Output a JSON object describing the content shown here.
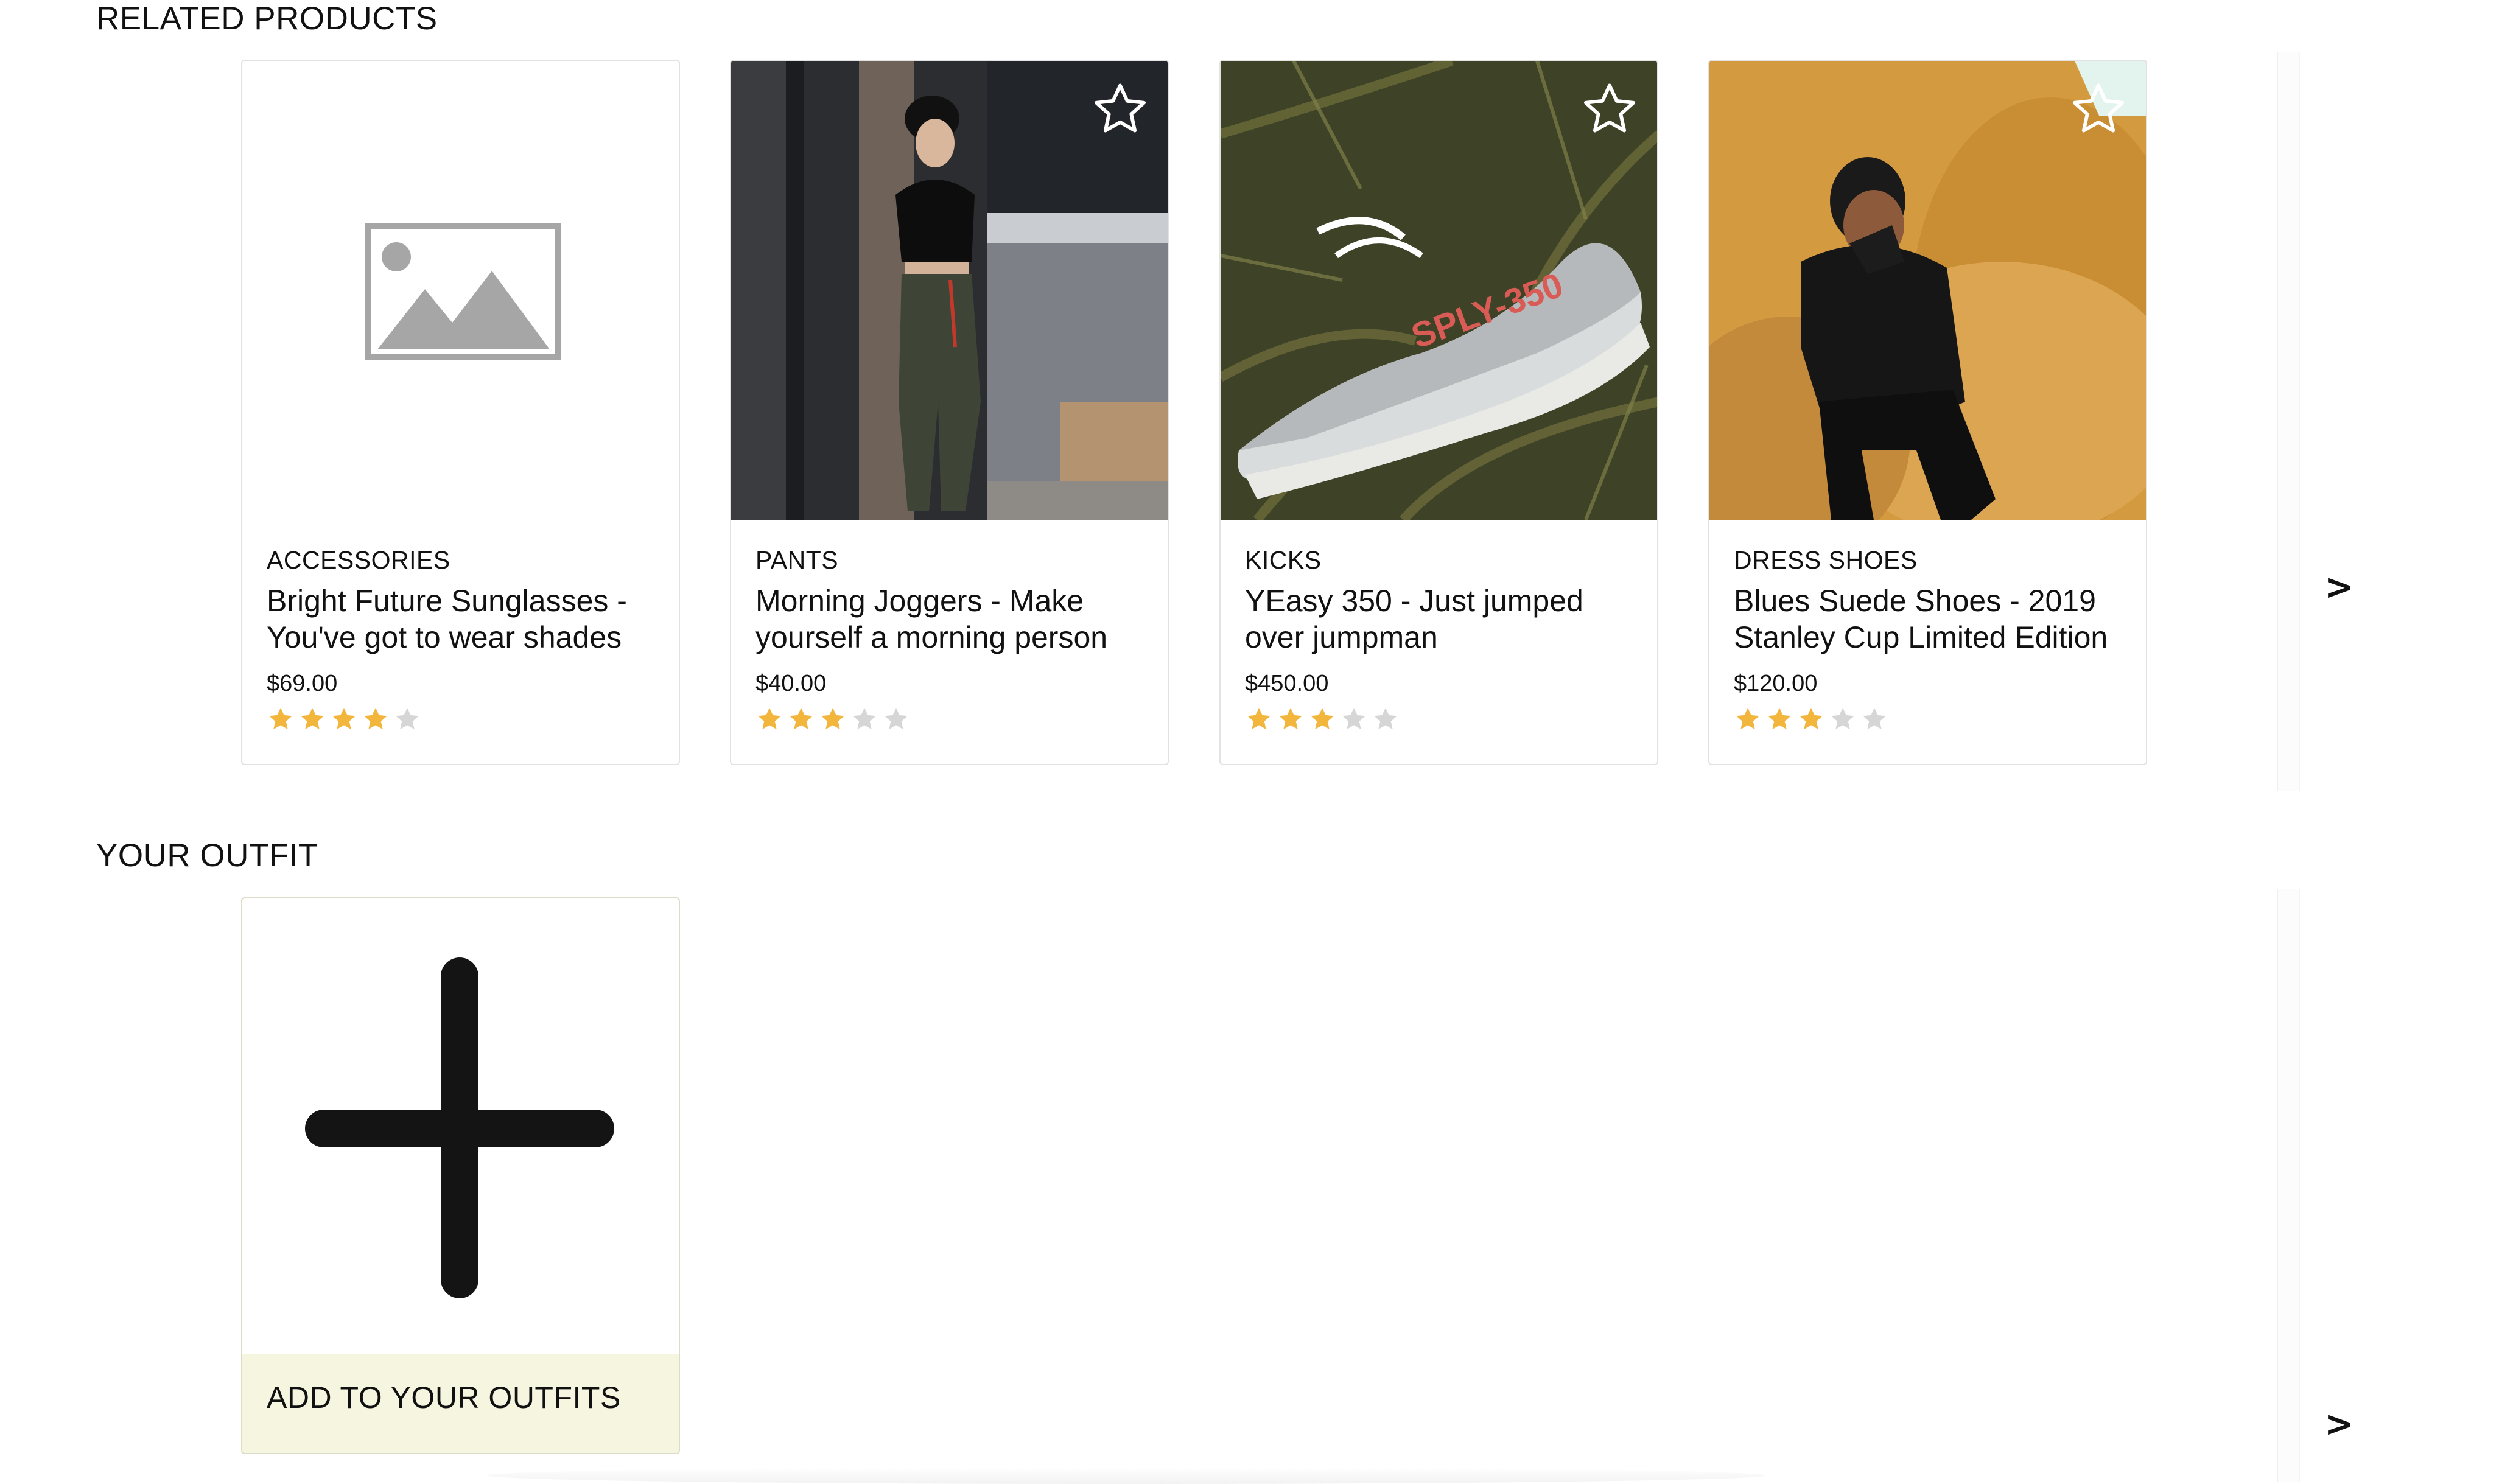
{
  "related": {
    "title": "RELATED PRODUCTS",
    "next_label": ">",
    "products": [
      {
        "category": "ACCESSORIES",
        "name": "Bright Future Sunglasses - You've got to wear shades",
        "price": "$69.00",
        "rating": 4,
        "max_rating": 5,
        "image": "placeholder-image-icon"
      },
      {
        "category": "PANTS",
        "name": "Morning Joggers - Make yourself a morning person",
        "price": "$40.00",
        "rating": 3,
        "max_rating": 5,
        "image": "woman-in-joggers-photo"
      },
      {
        "category": "KICKS",
        "name": "YEasy 350 - Just jumped over jumpman",
        "price": "$450.00",
        "rating": 3,
        "max_rating": 5,
        "image": "sneaker-on-ferns-photo",
        "image_text": "SPLY-350"
      },
      {
        "category": "DRESS SHOES",
        "name": "Blues Suede Shoes - 2019 Stanley Cup Limited Edition",
        "price": "$120.00",
        "rating": 3,
        "max_rating": 5,
        "image": "man-on-fur-chair-photo"
      }
    ]
  },
  "outfit": {
    "title": "YOUR OUTFIT",
    "add_label": "ADD TO YOUR OUTFITS",
    "next_label": ">"
  },
  "colors": {
    "star_filled": "#f2b63d",
    "star_empty": "#d6d6d6",
    "add_footer_bg": "#f5f5e0"
  }
}
